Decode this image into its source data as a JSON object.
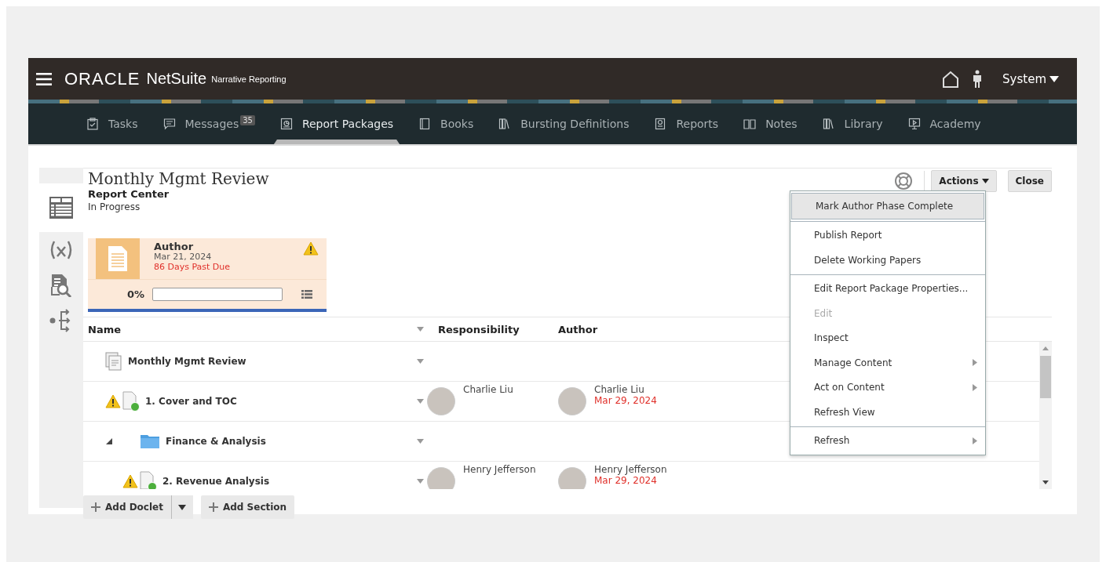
{
  "header": {
    "logo_word": "ORACLE",
    "logo_product": "NetSuite",
    "app_name": "Narrative Reporting",
    "user": "System"
  },
  "nav": [
    {
      "label": "Tasks",
      "selected": false
    },
    {
      "label": "Messages",
      "badge": "35",
      "selected": false
    },
    {
      "label": "Report Packages",
      "selected": true
    },
    {
      "label": "Books",
      "selected": false
    },
    {
      "label": "Bursting Definitions",
      "selected": false
    },
    {
      "label": "Reports",
      "selected": false
    },
    {
      "label": "Notes",
      "selected": false
    },
    {
      "label": "Library",
      "selected": false
    },
    {
      "label": "Academy",
      "selected": false
    }
  ],
  "rail": [
    {
      "selected": true
    },
    {
      "selected": false
    },
    {
      "selected": false
    },
    {
      "selected": false
    }
  ],
  "page": {
    "title": "Monthly Mgmt Review",
    "subtitle": "Report Center",
    "status": "In Progress"
  },
  "phase": {
    "name": "Author",
    "date": "Mar 21, 2024",
    "due": "86 Days Past Due",
    "warning": true,
    "percent": "0%",
    "level": 0
  },
  "toolbar": {
    "actions": "Actions",
    "close": "Close"
  },
  "menu": {
    "groups": [
      [
        {
          "label": "Mark Author Phase Complete",
          "selected": true,
          "disabled": false,
          "submenu": false
        }
      ],
      [
        {
          "label": "Publish Report",
          "selected": false,
          "disabled": false,
          "submenu": false
        },
        {
          "label": "Delete Working Papers",
          "selected": false,
          "disabled": false,
          "submenu": false
        }
      ],
      [
        {
          "label": "Edit Report Package Properties...",
          "selected": false,
          "disabled": false,
          "submenu": false
        },
        {
          "label": "Edit",
          "selected": false,
          "disabled": true,
          "submenu": false
        },
        {
          "label": "Inspect",
          "selected": false,
          "disabled": false,
          "submenu": false
        },
        {
          "label": "Manage Content",
          "selected": false,
          "disabled": false,
          "submenu": true
        },
        {
          "label": "Act on Content",
          "selected": false,
          "disabled": false,
          "submenu": true
        },
        {
          "label": "Refresh View",
          "selected": false,
          "disabled": false,
          "submenu": false
        }
      ],
      [
        {
          "label": "Refresh",
          "selected": false,
          "disabled": false,
          "submenu": true
        }
      ]
    ]
  },
  "table": {
    "columns": [
      "Name",
      "Responsibility",
      "Author"
    ],
    "rows": [
      {
        "kind": "package",
        "name": "Monthly Mgmt Review",
        "warning": false,
        "children": [
          {
            "kind": "doclet",
            "name": "1. Cover and TOC",
            "warning": true,
            "responsibility": "Charlie Liu",
            "author": "Charlie Liu",
            "author_date": "Mar 29, 2024"
          },
          {
            "kind": "section",
            "name": "Finance & Analysis",
            "warning": false,
            "expanded": true,
            "children": [
              {
                "kind": "doclet",
                "name": "2. Revenue Analysis",
                "warning": true,
                "responsibility": "Henry Jefferson",
                "author": "Henry Jefferson",
                "author_date": "Mar 29, 2024"
              }
            ]
          }
        ]
      }
    ]
  },
  "buttons": [
    {
      "label": "Add Doclet",
      "dropdown": true
    },
    {
      "label": "Add Section",
      "dropdown": false
    }
  ]
}
